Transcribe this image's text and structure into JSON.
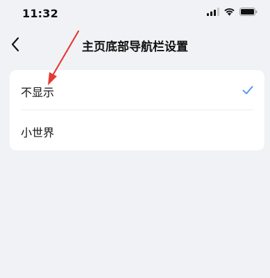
{
  "status_bar": {
    "time": "11:32",
    "icons": [
      "cellular-signal-icon",
      "wifi-icon",
      "battery-icon"
    ]
  },
  "nav": {
    "back_icon": "chevron-left-icon",
    "title": "主页底部导航栏设置"
  },
  "options": [
    {
      "label": "不显示",
      "selected": true
    },
    {
      "label": "小世界",
      "selected": false
    }
  ],
  "colors": {
    "background": "#f1f2f5",
    "card": "#ffffff",
    "accent": "#4a90f0",
    "annotation": "#e53935"
  }
}
